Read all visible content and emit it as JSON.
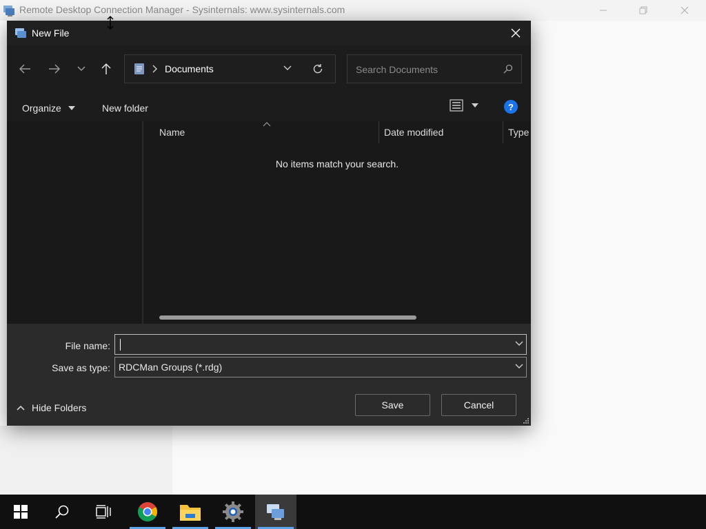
{
  "app": {
    "title": "Remote Desktop Connection Manager - Sysinternals: www.sysinternals.com",
    "icon": "rdcman-app-icon"
  },
  "dialog": {
    "title": "New File",
    "nav": {
      "back_icon": "arrow-left-icon",
      "forward_icon": "arrow-right-icon",
      "recent_icon": "chevron-down-icon",
      "up_icon": "arrow-up-icon"
    },
    "address": {
      "crumb": "Documents",
      "refresh_icon": "refresh-icon"
    },
    "search": {
      "placeholder": "Search Documents"
    },
    "commands": {
      "organize": "Organize",
      "new_folder": "New folder",
      "view_icon": "details-view-icon",
      "help": "?"
    },
    "columns": [
      "Name",
      "Date modified",
      "Type"
    ],
    "empty_message": "No items match your search.",
    "file_name_label": "File name:",
    "file_name_value": "",
    "save_type_label": "Save as type:",
    "save_type_value": "RDCMan Groups (*.rdg)",
    "hide_folders": "Hide Folders",
    "save_button": "Save",
    "cancel_button": "Cancel"
  },
  "taskbar": {
    "items": [
      "start-icon",
      "search-icon",
      "task-view-icon",
      "chrome-icon",
      "file-explorer-icon",
      "settings-icon",
      "rdcman-icon"
    ]
  },
  "colors": {
    "dialog_bg": "#202020",
    "bottom_bg": "#2b2b2b",
    "accent": "#1a73e8",
    "taskbar_indicator": "#5ea4e8"
  }
}
